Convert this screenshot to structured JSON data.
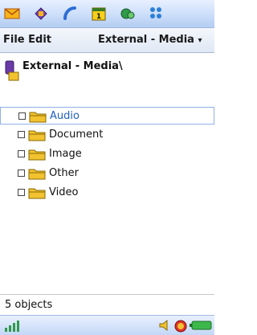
{
  "app_bar": {
    "icons": [
      "mail-icon",
      "messaging-icon",
      "phone-icon",
      "calendar-icon",
      "contacts-icon",
      "apps-grid-icon"
    ]
  },
  "menu": {
    "file_edit_label": "File Edit",
    "location_label": "External - Media"
  },
  "path": {
    "title": "External - Media\\"
  },
  "tree": {
    "items": [
      {
        "label": "Audio",
        "selected": true
      },
      {
        "label": "Document",
        "selected": false
      },
      {
        "label": "Image",
        "selected": false
      },
      {
        "label": "Other",
        "selected": false
      },
      {
        "label": "Video",
        "selected": false
      }
    ]
  },
  "status": {
    "text": "5 objects"
  },
  "bottom_bar": {
    "icons": [
      "signal-icon",
      "volume-icon",
      "alarm-icon",
      "battery-icon"
    ]
  },
  "colors": {
    "accent": "#1f5fbf",
    "folder": "#f2c230"
  }
}
